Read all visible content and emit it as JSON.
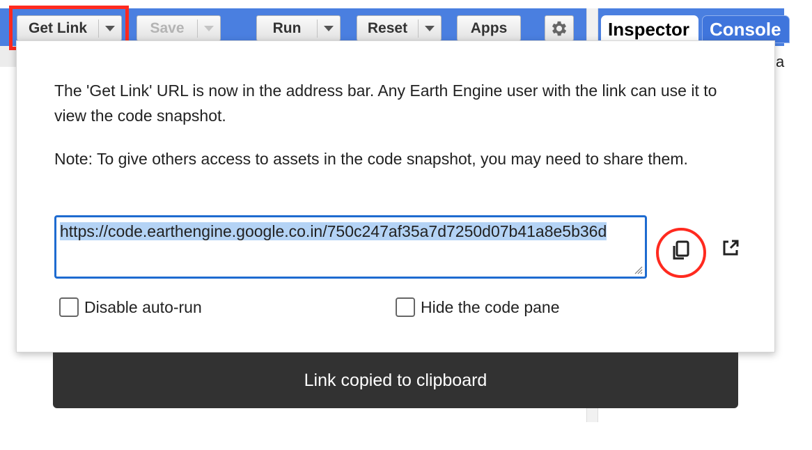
{
  "toolbar": {
    "get_link_label": "Get Link",
    "save_label": "Save",
    "run_label": "Run",
    "reset_label": "Reset",
    "apps_label": "Apps"
  },
  "tabs": {
    "inspector": "Inspector",
    "console": "Console"
  },
  "right_edge_char": "a",
  "dialog": {
    "message": "The 'Get Link' URL is now in the address bar. Any Earth Engine user with the link can use it to view the code snapshot.",
    "note": "Note: To give others access to assets in the code snapshot, you may need to share them.",
    "url": "https://code.earthengine.google.co.in/750c247af35a7d7250d07b41a8e5b36d",
    "disable_autorun_label": "Disable auto-run",
    "hide_code_pane_label": "Hide the code pane",
    "disable_autorun_checked": false,
    "hide_code_pane_checked": false
  },
  "snackbar": {
    "text": "Link copied to clipboard"
  },
  "colors": {
    "toolbar_blue": "#4a7fe0",
    "highlight_red": "#ff2a1f",
    "url_border": "#1e6bd0",
    "snackbar_bg": "#323232"
  }
}
